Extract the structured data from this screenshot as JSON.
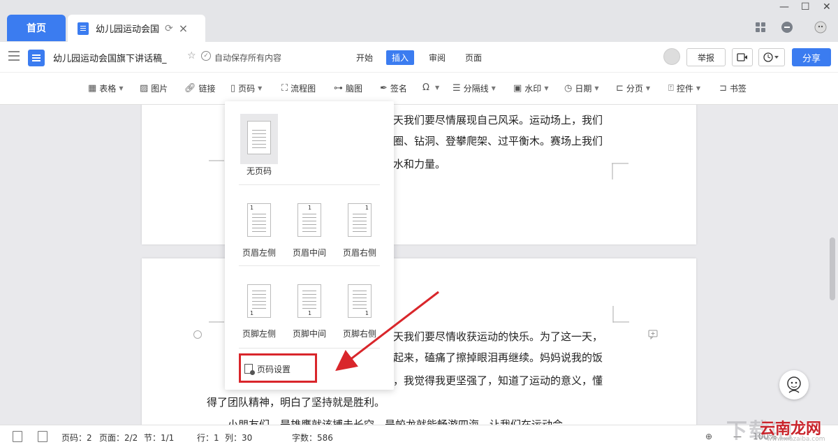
{
  "tabs": {
    "home_label": "首页",
    "doc_label": "幼儿园运动会国"
  },
  "menubar": {
    "doc_title": "幼儿园运动会国旗下讲话稿_",
    "autosave": "自动保存所有内容",
    "menus": [
      "开始",
      "插入",
      "审阅",
      "页面"
    ],
    "active_menu": "插入",
    "report_label": "举报",
    "share_label": "分享"
  },
  "toolbar": {
    "items": [
      {
        "label": "表格",
        "icon": "table-icon",
        "caret": true
      },
      {
        "label": "图片",
        "icon": "image-icon",
        "caret": false
      },
      {
        "label": "链接",
        "icon": "link-icon",
        "caret": false
      },
      {
        "label": "页码",
        "icon": "page-number-icon",
        "caret": true
      },
      {
        "label": "流程图",
        "icon": "flowchart-icon",
        "caret": false
      },
      {
        "label": "脑图",
        "icon": "mindmap-icon",
        "caret": false
      },
      {
        "label": "签名",
        "icon": "signature-icon",
        "caret": false
      },
      {
        "label": "",
        "icon": "omega-icon",
        "caret": true
      },
      {
        "label": "分隔线",
        "icon": "divider-icon",
        "caret": true
      },
      {
        "label": "水印",
        "icon": "watermark-icon",
        "caret": true
      },
      {
        "label": "日期",
        "icon": "clock-icon",
        "caret": true
      },
      {
        "label": "分页",
        "icon": "page-break-icon",
        "caret": true
      },
      {
        "label": "控件",
        "icon": "control-icon",
        "caret": true
      },
      {
        "label": "书签",
        "icon": "bookmark-icon",
        "caret": false
      }
    ]
  },
  "document": {
    "page1_lines": [
      "天我们要尽情展现自己风采。运动场上，我们",
      "圈、钻洞、登攀爬架、过平衡木。赛场上我们",
      "水和力量。"
    ],
    "page2_lines": [
      "天我们要尽情收获运动的快乐。为了这一天，",
      "起来，磕痛了擦掉眼泪再继续。妈妈说我的饭",
      "，我觉得我更坚强了，知道了运动的意义，懂",
      "得了团队精神，明白了坚持就是胜利。",
      "小朋友们，是雄鹰就该搏击长空，是蛟龙就能畅游四海，让我们在运动会"
    ]
  },
  "dropdown": {
    "no_page_number": "无页码",
    "header_options": [
      "页眉左侧",
      "页眉中间",
      "页眉右侧"
    ],
    "footer_options": [
      "页脚左侧",
      "页脚中间",
      "页脚右侧"
    ],
    "page_setting": "页码设置",
    "page_num_digit": "1"
  },
  "statusbar": {
    "page_code": "页码：2",
    "page": "页面：2/2",
    "section": "节：1/1",
    "line": "行：1",
    "column": "列：30",
    "word_count": "字数：586",
    "zoom": "100%"
  },
  "watermark": {
    "text": "下载吧",
    "logo": "云南龙网",
    "url": "www.xiazaiba.com"
  },
  "colors": {
    "accent": "#3b7cf0",
    "highlight": "#d9262b"
  }
}
